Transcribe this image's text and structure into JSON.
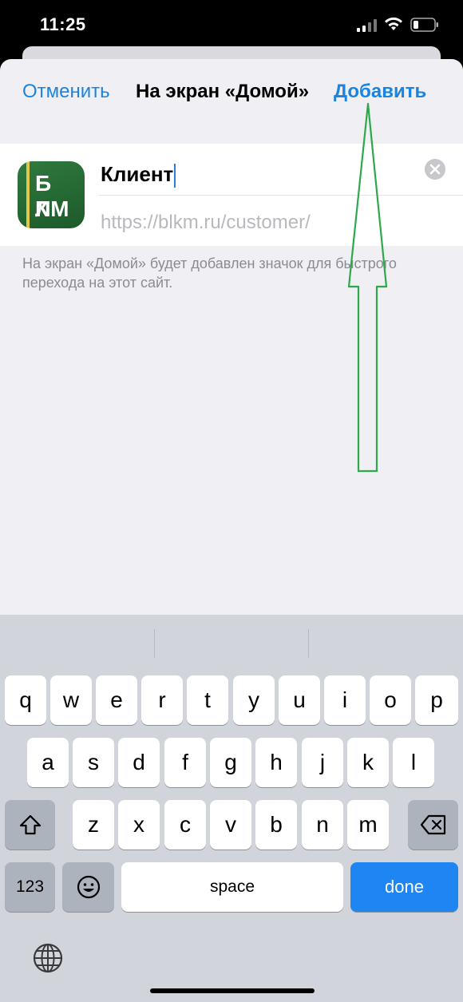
{
  "status_bar": {
    "time": "11:25"
  },
  "nav": {
    "cancel_label": "Отменить",
    "title": "На экран «Домой»",
    "add_label": "Добавить"
  },
  "app_icon": {
    "logo_top": "Б Л",
    "logo_bottom": "КМ"
  },
  "form": {
    "name_value": "Клиент",
    "url_value": "https://blkm.ru/customer/"
  },
  "description": "На экран «Домой» будет добавлен значок для быстрого перехода на этот сайт.",
  "keyboard": {
    "row1": [
      "q",
      "w",
      "e",
      "r",
      "t",
      "y",
      "u",
      "i",
      "o",
      "p"
    ],
    "row2": [
      "a",
      "s",
      "d",
      "f",
      "g",
      "h",
      "j",
      "k",
      "l"
    ],
    "row3": [
      "z",
      "x",
      "c",
      "v",
      "b",
      "n",
      "m"
    ],
    "numbers_label": "123",
    "space_label": "space",
    "done_label": "done"
  },
  "icons": [
    "signal-icon",
    "wifi-icon",
    "battery-icon",
    "clear-icon",
    "shift-icon",
    "delete-icon",
    "emoji-icon",
    "globe-icon"
  ],
  "colors": {
    "accent": "#1a84e0",
    "done_key": "#1f85f2",
    "annotation": "#2ea84a"
  }
}
